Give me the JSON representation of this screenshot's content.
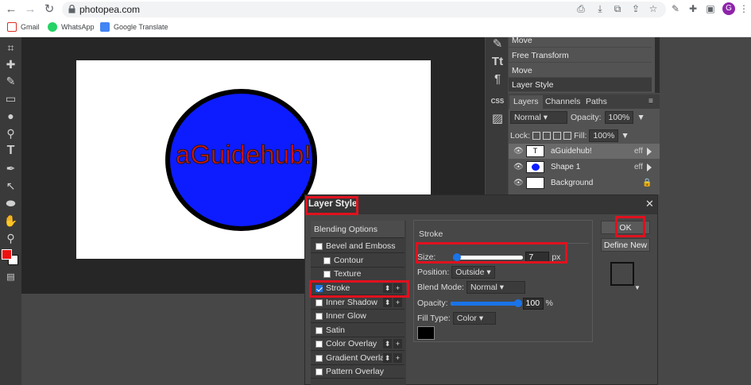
{
  "browser": {
    "url": "photopea.com",
    "avatar_letter": "G",
    "bookmarks": [
      {
        "label": "Gmail",
        "icon": "gmail-icon",
        "color": "#d93025"
      },
      {
        "label": "WhatsApp",
        "icon": "whatsapp-icon",
        "color": "#25d366"
      },
      {
        "label": "Google Translate",
        "icon": "translate-icon",
        "color": "#4285f4"
      }
    ]
  },
  "canvas": {
    "text": "aGuidehub!"
  },
  "history": {
    "items": [
      "Move",
      "Free Transform",
      "Move",
      "Layer Style"
    ]
  },
  "side_icons": {
    "css_label": "CSS"
  },
  "layers_panel": {
    "tabs": [
      "Layers",
      "Channels",
      "Paths"
    ],
    "blend_mode": "Normal",
    "opacity_label": "Opacity:",
    "opacity_value": "100%",
    "lock_label": "Lock:",
    "fill_label": "Fill:",
    "fill_value": "100%",
    "layers": [
      {
        "name": "aGuidehub!",
        "effect": "eff"
      },
      {
        "name": "Shape 1",
        "effect": "eff"
      },
      {
        "name": "Background",
        "effect": ""
      }
    ]
  },
  "dialog": {
    "title": "Layer Style",
    "list": {
      "header": "Blending Options",
      "items": [
        {
          "label": "Bevel and Emboss"
        },
        {
          "label": "Contour"
        },
        {
          "label": "Texture"
        },
        {
          "label": "Stroke"
        },
        {
          "label": "Inner Shadow"
        },
        {
          "label": "Inner Glow"
        },
        {
          "label": "Satin"
        },
        {
          "label": "Color Overlay"
        },
        {
          "label": "Gradient Overlay"
        },
        {
          "label": "Pattern Overlay"
        }
      ],
      "plus": "+",
      "updown": "⬍"
    },
    "stroke": {
      "title": "Stroke",
      "size_label": "Size:",
      "size_value": "7",
      "size_unit": "px",
      "position_label": "Position:",
      "position_value": "Outside",
      "blend_label": "Blend Mode:",
      "blend_value": "Normal",
      "opacity_label": "Opacity:",
      "opacity_value": "100",
      "opacity_unit": "%",
      "filltype_label": "Fill Type:",
      "filltype_value": "Color",
      "color": "#000000"
    },
    "buttons": {
      "ok": "OK",
      "define_new": "Define New"
    }
  },
  "colors": {
    "highlight": "#e0111e",
    "accent": "#1a73e8",
    "foreground_swatch": "#ee1111",
    "background_swatch": "#ffffff",
    "ellipse_fill": "#0d1cff",
    "text_color": "#dd1111"
  }
}
